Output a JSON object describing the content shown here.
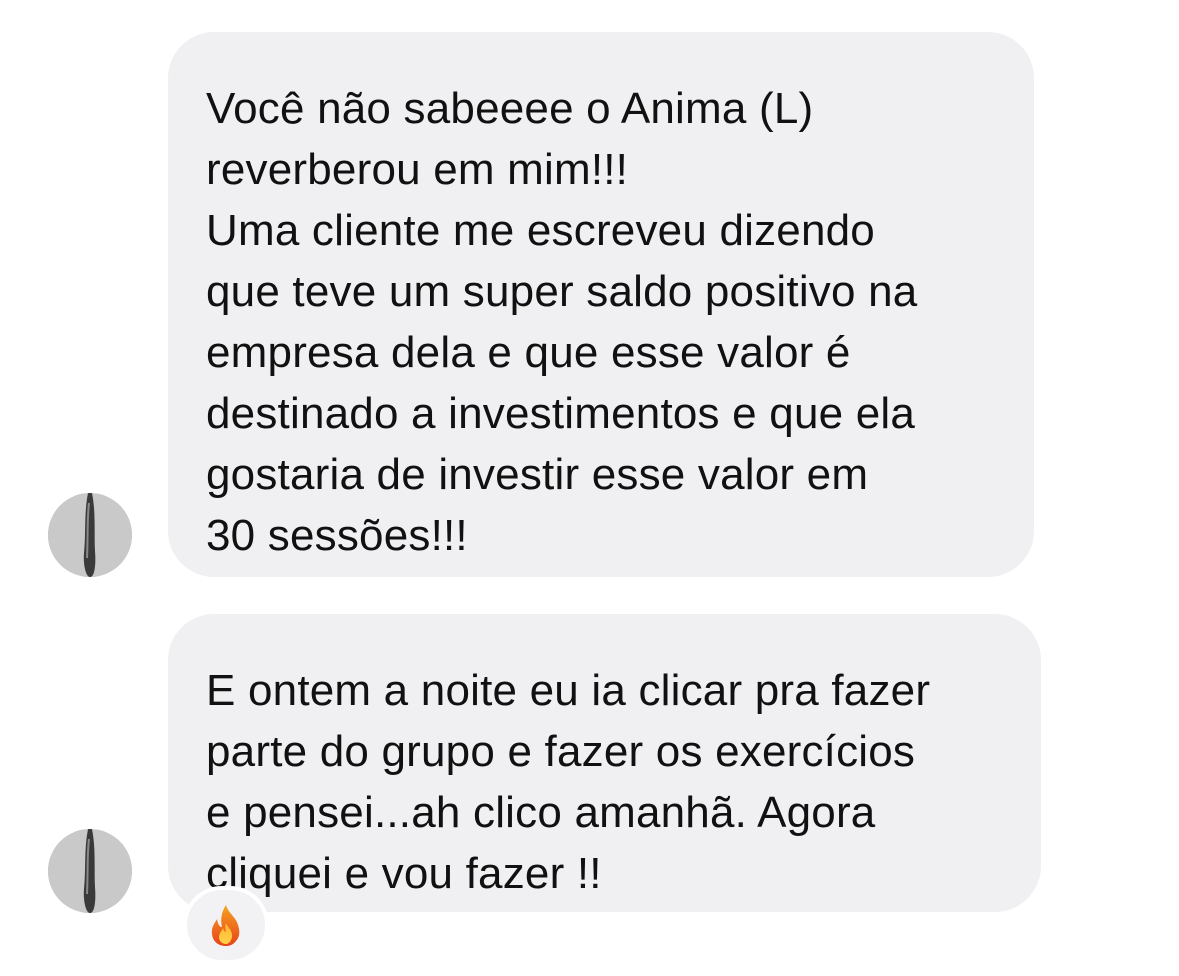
{
  "messages": [
    {
      "lines": [
        "Você não sabeeee  o Anima (L)",
        "reverberou em mim!!!",
        "Uma cliente me escreveu dizendo",
        "que teve um super saldo positivo na",
        "empresa dela e que esse valor é",
        "destinado a investimentos e que ela",
        "gostaria de investir esse valor em",
        "30 sessões!!!"
      ]
    },
    {
      "lines": [
        "E ontem a noite eu ia clicar pra fazer",
        "parte do grupo e fazer os exercícios",
        "e pensei...ah clico amanhã. Agora",
        "cliquei e vou fazer !!"
      ],
      "reaction": "fire-emoji"
    }
  ],
  "colors": {
    "bubble": "#f0f0f2",
    "text": "#111111",
    "background": "#ffffff"
  },
  "icons": {
    "avatar": "profile-photo",
    "reaction": "fire-icon"
  }
}
